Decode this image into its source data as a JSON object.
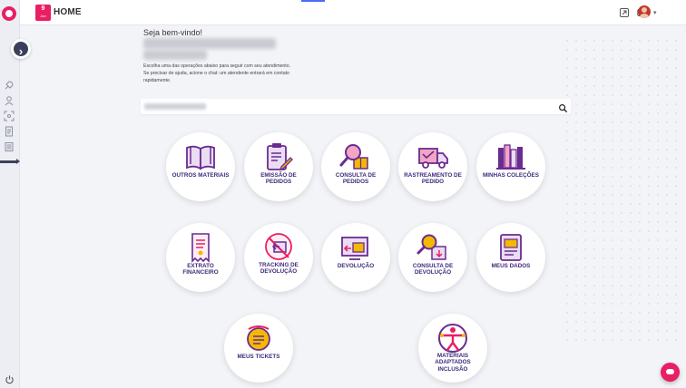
{
  "header": {
    "date_day": "9",
    "date_month": "Jan",
    "title": "HOME",
    "icons": [
      "tablet-icon",
      "video-icon",
      "user-avatar"
    ]
  },
  "welcome": {
    "greeting": "Seja bem-vindo!",
    "intro_line1": "Escolha uma das operações abaixo para seguir com seu atendimento.",
    "intro_line2": "Se precisar de ajuda, acione o chat: um atendente entrará em contato rapidamente."
  },
  "search": {
    "placeholder": ""
  },
  "sidebar": {
    "items": [
      "rocket-icon",
      "user-icon",
      "scan-icon",
      "document-icon",
      "list-icon"
    ]
  },
  "tiles": [
    {
      "label": "OUTROS MATERIAIS",
      "icon": "book-icon"
    },
    {
      "label": "EMISSÃO DE PEDIDOS",
      "icon": "clipboard-edit-icon"
    },
    {
      "label": "CONSULTA DE PEDIDOS",
      "icon": "search-box-icon"
    },
    {
      "label": "RASTREAMENTO DE PEDIDO",
      "icon": "truck-icon"
    },
    {
      "label": "MINHAS COLEÇÕES",
      "icon": "books-icon"
    },
    {
      "label": "EXTRATO FINANCEIRO",
      "icon": "receipt-icon"
    },
    {
      "label": "TRACKING DE DEVOLUÇÃO",
      "icon": "return-tracking-icon"
    },
    {
      "label": "DEVOLUÇÃO",
      "icon": "return-screen-icon"
    },
    {
      "label": "CONSULTA DE DEVOLUÇÃO",
      "icon": "search-return-icon"
    },
    {
      "label": "MEUS DADOS",
      "icon": "profile-book-icon"
    },
    {
      "label": "MEUS TICKETS",
      "icon": "ticket-icon"
    },
    {
      "label": "MATERIAIS ADAPTADOS INCLUSÃO",
      "icon": "accessibility-icon"
    }
  ],
  "colors": {
    "brand": "#e91e63",
    "primary": "#6a2c91",
    "accent": "#f5b800",
    "label": "#3d2a78"
  }
}
